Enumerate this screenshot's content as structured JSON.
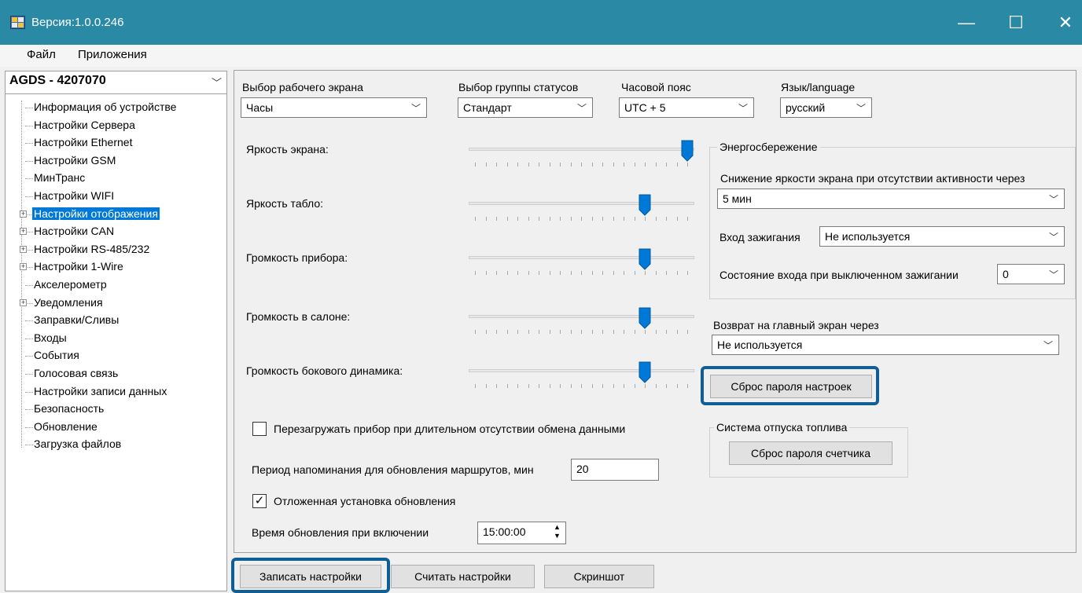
{
  "window": {
    "title": "Версия:1.0.0.246",
    "controls": {
      "minimize": "—",
      "maximize": "☐",
      "close": "✕"
    },
    "accent_color": "#2a8aa6"
  },
  "menu": [
    "Файл",
    "Приложения"
  ],
  "device": {
    "name": "AGDS - 4207070"
  },
  "tree": [
    {
      "label": "Информация об устройстве",
      "expandable": false
    },
    {
      "label": "Настройки Сервера",
      "expandable": false
    },
    {
      "label": "Настройки Ethernet",
      "expandable": false
    },
    {
      "label": "Настройки GSM",
      "expandable": false
    },
    {
      "label": "МинТранс",
      "expandable": false
    },
    {
      "label": "Настройки WIFI",
      "expandable": false
    },
    {
      "label": "Настройки отображения",
      "expandable": true,
      "selected": true
    },
    {
      "label": "Настройки CAN",
      "expandable": true
    },
    {
      "label": "Настройки RS-485/232",
      "expandable": true
    },
    {
      "label": "Настройки 1-Wire",
      "expandable": true
    },
    {
      "label": "Акселерометр",
      "expandable": false
    },
    {
      "label": "Уведомления",
      "expandable": true
    },
    {
      "label": "Заправки/Сливы",
      "expandable": false
    },
    {
      "label": "Входы",
      "expandable": false
    },
    {
      "label": "События",
      "expandable": false
    },
    {
      "label": "Голосовая связь",
      "expandable": false
    },
    {
      "label": "Настройки записи данных",
      "expandable": false
    },
    {
      "label": "Безопасность",
      "expandable": false
    },
    {
      "label": "Обновление",
      "expandable": false
    },
    {
      "label": "Загрузка файлов",
      "expandable": false
    }
  ],
  "top_selectors": {
    "screen": {
      "label": "Выбор рабочего экрана",
      "value": "Часы"
    },
    "status_group": {
      "label": "Выбор группы статусов",
      "value": "Стандарт"
    },
    "timezone": {
      "label": "Часовой пояс",
      "value": "UTC + 5"
    },
    "language": {
      "label": "Язык/language",
      "value": "русский"
    }
  },
  "sliders": [
    {
      "label": "Яркость экрана:",
      "level": 1.0
    },
    {
      "label": "Яркость табло:",
      "level": 0.8
    },
    {
      "label": "Громкость прибора:",
      "level": 0.8
    },
    {
      "label": "Громкость в салоне:",
      "level": 0.8
    },
    {
      "label": "Громкость бокового динамика:",
      "level": 0.8
    }
  ],
  "energy": {
    "title": "Энергосбережение",
    "dim_label": "Снижение яркости экрана при отсутствии активности через",
    "dim_value": "5 мин",
    "ignition_label": "Вход зажигания",
    "ignition_value": "Не используется",
    "input_state_label": "Состояние входа при выключенном зажигании",
    "input_state_value": "0"
  },
  "return_home": {
    "label": "Возврат на главный экран через",
    "value": "Не используется"
  },
  "reset_settings_password": "Сброс пароля настроек",
  "fuel_system": {
    "title": "Система отпуска топлива",
    "reset_counter_password": "Сброс пароля счетчика"
  },
  "reboot_checkbox": {
    "label": "Перезагружать прибор при длительном отсутствии обмена данными",
    "checked": false
  },
  "route_reminder": {
    "label": "Период напоминания для обновления маршрутов, мин",
    "value": "20"
  },
  "deferred_update": {
    "label": "Отложенная установка обновления",
    "checked": true,
    "mark": "✓"
  },
  "update_time": {
    "label": "Время обновления при включении",
    "value": "15:00:00"
  },
  "bottom_buttons": {
    "write": "Записать настройки",
    "read": "Считать настройки",
    "screenshot": "Скриншот"
  }
}
